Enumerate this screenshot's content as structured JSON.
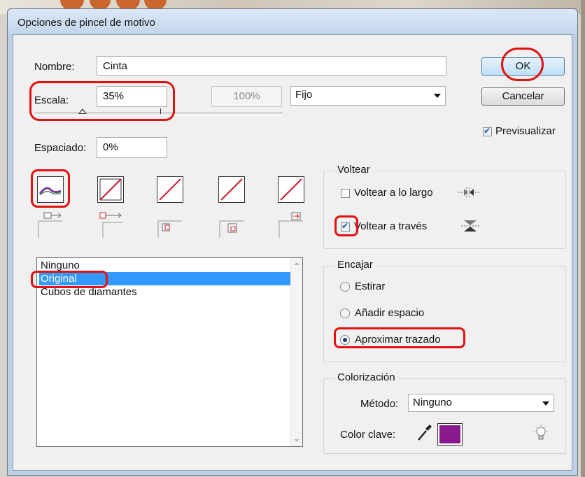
{
  "dialog": {
    "title": "Opciones de pincel de motivo"
  },
  "name": {
    "label": "Nombre:",
    "value": "Cinta"
  },
  "scale": {
    "label": "Escala:",
    "value": "35%",
    "max_value": "100%",
    "mode": "Fijo",
    "slider_fraction": 0.35
  },
  "spacing": {
    "label": "Espaciado:",
    "value": "0%"
  },
  "buttons": {
    "ok": "OK",
    "cancel": "Cancelar"
  },
  "preview": {
    "label": "Previsualizar",
    "checked": true
  },
  "tiles": [
    {
      "name": "tile-side",
      "kind": "ribbon"
    },
    {
      "name": "tile-outer-corner",
      "kind": "none"
    },
    {
      "name": "tile-inner-corner",
      "kind": "none"
    },
    {
      "name": "tile-start",
      "kind": "none"
    },
    {
      "name": "tile-end",
      "kind": "none"
    }
  ],
  "tile_list": {
    "items": [
      "Ninguno",
      "Original",
      "Cubos de diamantes"
    ],
    "selected_index": 1
  },
  "flip": {
    "legend": "Voltear",
    "along": {
      "label": "Voltear a lo largo",
      "checked": false
    },
    "across": {
      "label": "Voltear a través",
      "checked": true
    }
  },
  "fit": {
    "legend": "Encajar",
    "options": [
      "Estirar",
      "Añadir espacio",
      "Aproximar trazado"
    ],
    "selected_index": 2
  },
  "colorization": {
    "legend": "Colorización",
    "method_label": "Método:",
    "method_value": "Ninguno",
    "key_color_label": "Color clave:",
    "key_color": "#8a1a8c"
  },
  "colors": {
    "highlight": "#e41111",
    "selection": "#3399ff",
    "ribbon": "#7a3aa0"
  }
}
